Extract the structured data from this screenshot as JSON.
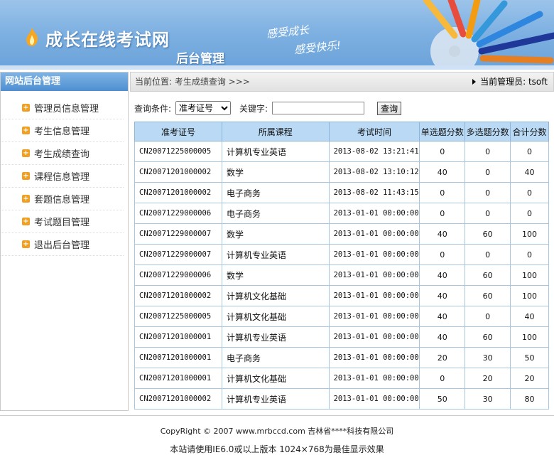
{
  "header": {
    "site_name": "成长在线考试网",
    "sub_name": "后台管理",
    "slogan_line1": "感受成长",
    "slogan_line2": "感受快乐!"
  },
  "sidebar": {
    "title": "网站后台管理",
    "items": [
      {
        "label": "管理员信息管理"
      },
      {
        "label": "考生信息管理"
      },
      {
        "label": "考生成绩查询"
      },
      {
        "label": "课程信息管理"
      },
      {
        "label": "套题信息管理"
      },
      {
        "label": "考试题目管理"
      },
      {
        "label": "退出后台管理"
      }
    ]
  },
  "breadcrumb": {
    "location": "当前位置: 考生成绩查询 >>>",
    "admin": "当前管理员: tsoft"
  },
  "search": {
    "condition_label": "查询条件:",
    "condition_value": "准考证号",
    "keyword_label": "关键字:",
    "keyword_value": "",
    "button": "查询"
  },
  "table": {
    "headers": [
      "准考证号",
      "所属课程",
      "考试时间",
      "单选题分数",
      "多选题分数",
      "合计分数"
    ],
    "rows": [
      [
        "CN20071225000005",
        "计算机专业英语",
        "2013-08-02 13:21:41",
        "0",
        "0",
        "0"
      ],
      [
        "CN20071201000002",
        "数学",
        "2013-08-02 13:10:12",
        "40",
        "0",
        "40"
      ],
      [
        "CN20071201000002",
        "电子商务",
        "2013-08-02 11:43:15",
        "0",
        "0",
        "0"
      ],
      [
        "CN20071229000006",
        "电子商务",
        "2013-01-01 00:00:00",
        "0",
        "0",
        "0"
      ],
      [
        "CN20071229000007",
        "数学",
        "2013-01-01 00:00:00",
        "40",
        "60",
        "100"
      ],
      [
        "CN20071229000007",
        "计算机专业英语",
        "2013-01-01 00:00:00",
        "0",
        "0",
        "0"
      ],
      [
        "CN20071229000006",
        "数学",
        "2013-01-01 00:00:00",
        "40",
        "60",
        "100"
      ],
      [
        "CN20071201000002",
        "计算机文化基础",
        "2013-01-01 00:00:00",
        "40",
        "60",
        "100"
      ],
      [
        "CN20071225000005",
        "计算机文化基础",
        "2013-01-01 00:00:00",
        "40",
        "0",
        "40"
      ],
      [
        "CN20071201000001",
        "计算机专业英语",
        "2013-01-01 00:00:00",
        "40",
        "60",
        "100"
      ],
      [
        "CN20071201000001",
        "电子商务",
        "2013-01-01 00:00:00",
        "20",
        "30",
        "50"
      ],
      [
        "CN20071201000001",
        "计算机文化基础",
        "2013-01-01 00:00:00",
        "0",
        "20",
        "20"
      ],
      [
        "CN20071201000002",
        "计算机专业英语",
        "2013-01-01 00:00:00",
        "50",
        "30",
        "80"
      ]
    ]
  },
  "footer": {
    "copyright": "CopyRight © 2007 www.mrbccd.com 吉林省****科技有限公司",
    "notice": "本站请使用IE6.0或以上版本 1024×768为最佳显示效果"
  },
  "colors": {
    "header_blue": "#7fb1e2",
    "table_header": "#b9d9f4",
    "menu_icon": "#f0a020"
  }
}
